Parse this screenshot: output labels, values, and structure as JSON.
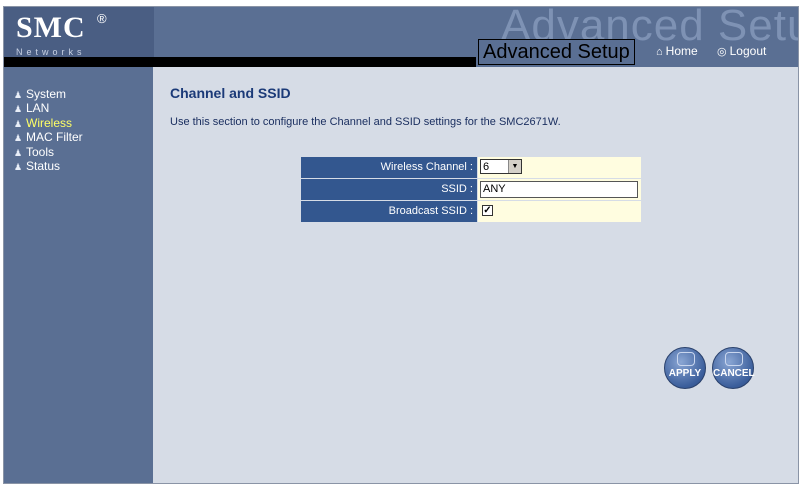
{
  "header": {
    "logo": "SMC",
    "logo_reg": "®",
    "logo_sub": "Networks",
    "watermark": "Advanced Setup",
    "title": "Advanced Setup",
    "home_label": "Home",
    "logout_label": "Logout",
    "home_icon": "home-icon",
    "logout_icon": "logout-icon"
  },
  "sidebar": {
    "items": [
      {
        "label": "System"
      },
      {
        "label": "LAN"
      },
      {
        "label": "Wireless",
        "active": true
      },
      {
        "label": "MAC Filter"
      },
      {
        "label": "Tools"
      },
      {
        "label": "Status"
      }
    ],
    "active_color": "#ffff66"
  },
  "main": {
    "title": "Channel and SSID",
    "description": "Use this section to configure the Channel and SSID settings for the SMC2671W.",
    "form": {
      "channel_label": "Wireless Channel :",
      "channel_value": "6",
      "ssid_label": "SSID :",
      "ssid_value": "ANY",
      "broadcast_label": "Broadcast SSID :",
      "broadcast_checked": true
    },
    "buttons": {
      "apply": "APPLY",
      "cancel": "CANCEL"
    }
  },
  "colors": {
    "sidebar": "#5a6f93",
    "label_cell": "#33578f",
    "value_cell": "#fffde0",
    "page_bg": "#d6dce6"
  }
}
